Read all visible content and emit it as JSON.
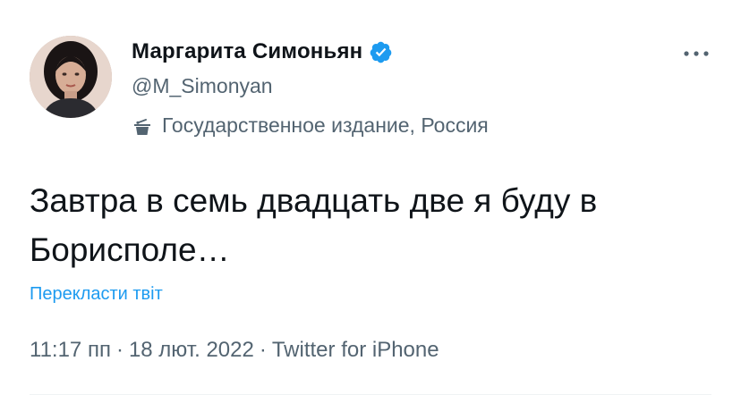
{
  "author": {
    "display_name": "Маргарита Симоньян",
    "handle": "@M_Simonyan",
    "verified": true,
    "label": "Государственное издание, Россия"
  },
  "icons": {
    "verified": "verified-badge-icon",
    "label": "podium-icon",
    "more": "more-horizontal-icon"
  },
  "tweet": {
    "text": "Завтра в семь двадцать две я буду в Борисполе…",
    "translate_label": "Перекласти твіт",
    "time": "11:17 пп",
    "date": "18 лют. 2022",
    "source": "Twitter for iPhone",
    "separator": "·"
  },
  "colors": {
    "accent": "#1d9bf0",
    "secondary_text": "#536471",
    "primary_text": "#0f1419"
  }
}
